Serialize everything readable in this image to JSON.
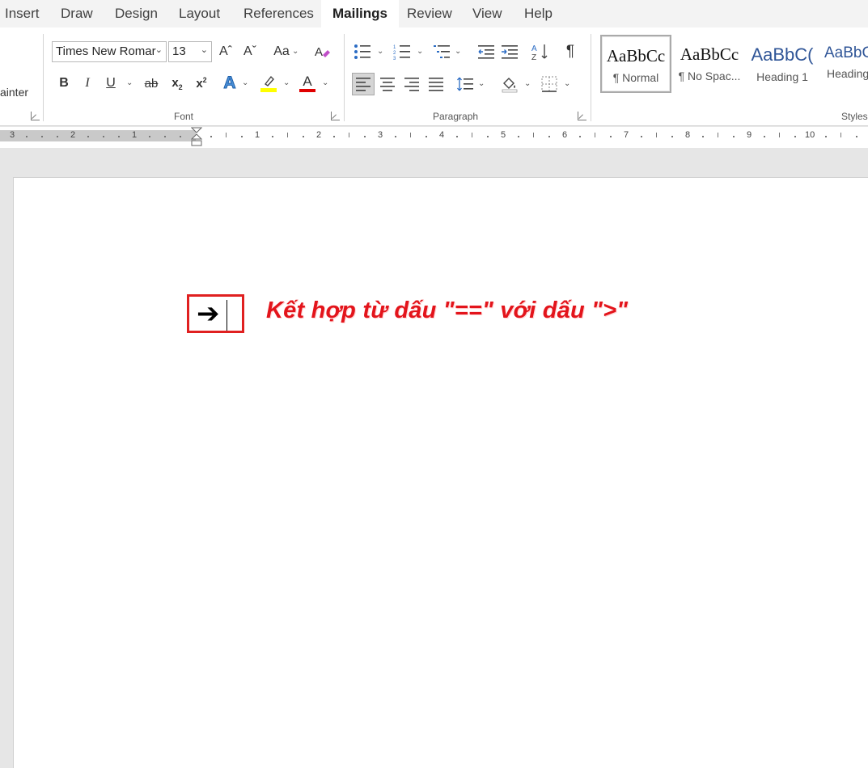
{
  "tabs": [
    "Insert",
    "Draw",
    "Design",
    "Layout",
    "References",
    "Mailings",
    "Review",
    "View",
    "Help"
  ],
  "active_tab": "Mailings",
  "clipboard": {
    "painter_fragment": "ainter"
  },
  "font": {
    "name": "Times New Romar",
    "size": "13",
    "group_label": "Font",
    "grow_glyph": "Aˆ",
    "shrink_glyph": "Aˇ",
    "case_glyph": "Aa",
    "bold": "B",
    "italic": "I",
    "underline": "U",
    "strike": "ab",
    "subscript": "x",
    "sub_mark": "2",
    "superscript": "x",
    "sup_mark": "2",
    "effects_glyph": "A",
    "font_color_glyph": "A",
    "highlight_color": "#ffff00",
    "font_color": "#e00000"
  },
  "paragraph": {
    "group_label": "Paragraph",
    "pilcrow": "¶"
  },
  "styles": {
    "group_label": "Styles",
    "items": [
      {
        "sample": "AaBbCc",
        "name": "¶ Normal"
      },
      {
        "sample": "AaBbCc",
        "name": "¶ No Spac..."
      },
      {
        "sample": "AaBbC(",
        "name": "Heading 1"
      },
      {
        "sample": "AaBbC",
        "name": "Heading"
      }
    ],
    "heading_color": "#2f5597"
  },
  "ruler": {
    "left_numbers": [
      "3",
      "2",
      "1"
    ],
    "right_numbers": [
      "1",
      "2",
      "3",
      "4",
      "5",
      "6",
      "7",
      "8",
      "9",
      "10"
    ]
  },
  "document": {
    "arrow_symbol": "➔",
    "caption": "Kết hợp từ dấu \"==\" với dấu \">\"",
    "caption_color": "#e3141b",
    "highlight_box_color": "#e02020"
  }
}
